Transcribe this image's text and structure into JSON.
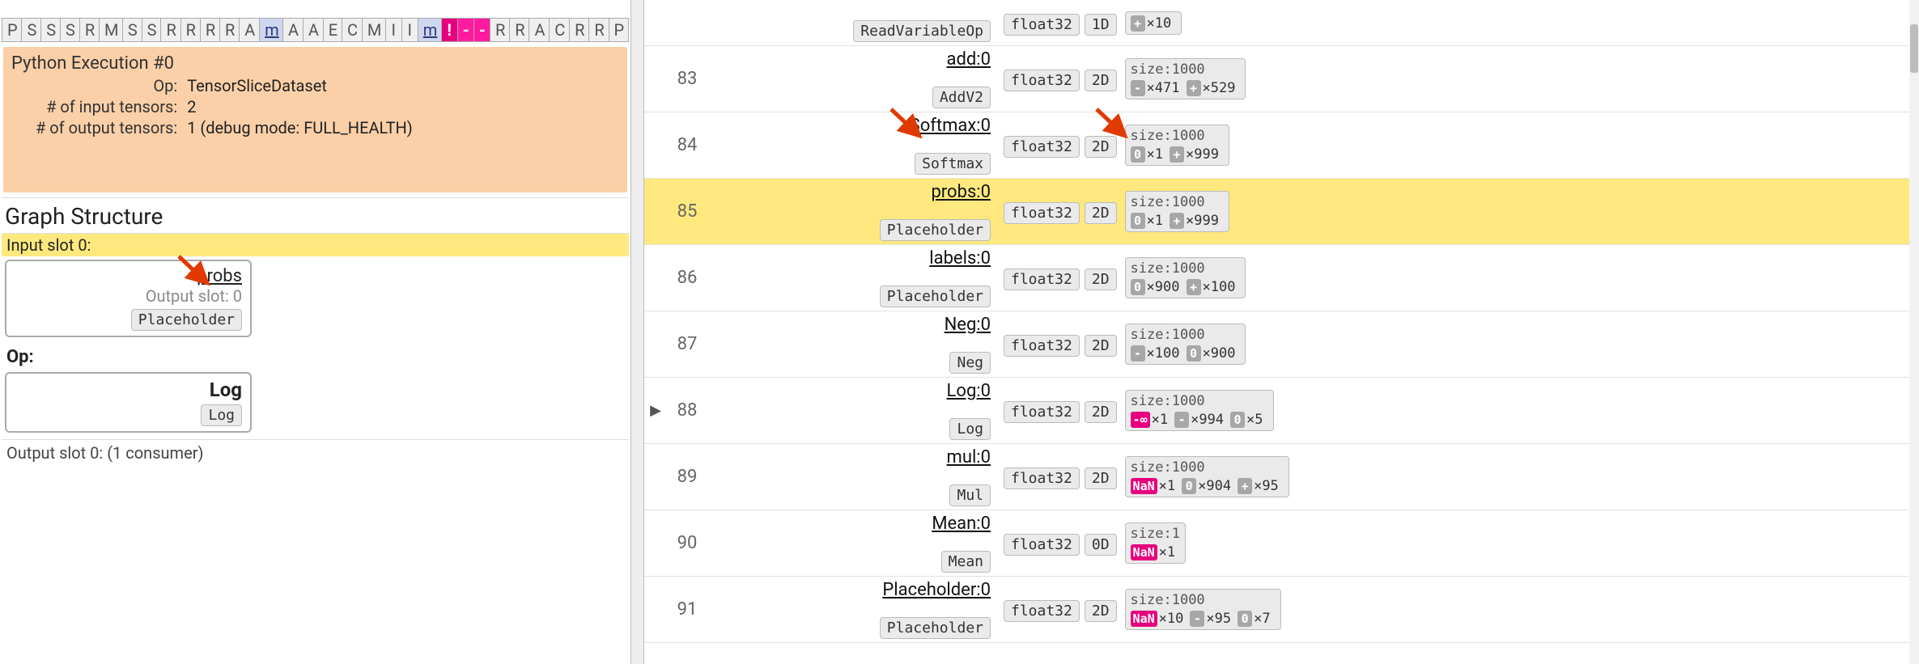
{
  "breadcrumb": [
    "P",
    "S",
    "S",
    "S",
    "R",
    "M",
    "S",
    "S",
    "R",
    "R",
    "R",
    "R",
    "A",
    "m",
    "A",
    "A",
    "E",
    "C",
    "M",
    "I",
    "I",
    "m",
    "!",
    "-",
    "-",
    "R",
    "R",
    "A",
    "C",
    "R",
    "R",
    "P"
  ],
  "breadcrumb_styles": {
    "13": "underline",
    "21": "underline",
    "22": "magenta",
    "23": "magenta hl",
    "24": "magenta hl"
  },
  "detail": {
    "title": "Python Execution #0",
    "rows": [
      {
        "k": "Op:",
        "v": "TensorSliceDataset"
      },
      {
        "k": "# of input tensors:",
        "v": "2"
      },
      {
        "k": "# of output tensors:",
        "v": "1   (debug mode: FULL_HEALTH)"
      }
    ]
  },
  "graph_structure_heading": "Graph Structure",
  "input_slot_label": "Input slot 0:",
  "input_slot": {
    "name": "probs",
    "sub": "Output slot: 0",
    "chip": "Placeholder"
  },
  "op_label": "Op:",
  "op_box": {
    "name": "Log",
    "chip": "Log"
  },
  "output_slot_label": "Output slot 0: (1 consumer)",
  "rows": [
    {
      "idx": "",
      "name": "",
      "op": "ReadVariableOp",
      "dtype": "float32",
      "dims": "1D",
      "size": "",
      "stats": [
        {
          "tag": "plus",
          "txt": "×10"
        }
      ],
      "partial_top": true
    },
    {
      "idx": "83",
      "name": "add:0",
      "op": "AddV2",
      "dtype": "float32",
      "dims": "2D",
      "size": "size:1000",
      "stats": [
        {
          "tag": "minus",
          "txt": "×471"
        },
        {
          "tag": "plus",
          "txt": "×529"
        }
      ]
    },
    {
      "idx": "84",
      "name": "Softmax:0",
      "op": "Softmax",
      "dtype": "float32",
      "dims": "2D",
      "size": "size:1000",
      "stats": [
        {
          "tag": "zero",
          "txt": "×1"
        },
        {
          "tag": "plus",
          "txt": "×999"
        }
      ]
    },
    {
      "idx": "85",
      "name": "probs:0",
      "op": "Placeholder",
      "dtype": "float32",
      "dims": "2D",
      "size": "size:1000",
      "stats": [
        {
          "tag": "zero",
          "txt": "×1"
        },
        {
          "tag": "plus",
          "txt": "×999"
        }
      ],
      "highlight": true
    },
    {
      "idx": "86",
      "name": "labels:0",
      "op": "Placeholder",
      "dtype": "float32",
      "dims": "2D",
      "size": "size:1000",
      "stats": [
        {
          "tag": "zero",
          "txt": "×900"
        },
        {
          "tag": "plus",
          "txt": "×100"
        }
      ]
    },
    {
      "idx": "87",
      "name": "Neg:0",
      "op": "Neg",
      "dtype": "float32",
      "dims": "2D",
      "size": "size:1000",
      "stats": [
        {
          "tag": "minus",
          "txt": "×100"
        },
        {
          "tag": "zero",
          "txt": "×900"
        }
      ]
    },
    {
      "idx": "88",
      "name": "Log:0",
      "op": "Log",
      "dtype": "float32",
      "dims": "2D",
      "size": "size:1000",
      "stats": [
        {
          "tag": "neginf",
          "txt": "×1"
        },
        {
          "tag": "minus",
          "txt": "×994"
        },
        {
          "tag": "zero",
          "txt": "×5"
        }
      ],
      "expandable": true
    },
    {
      "idx": "89",
      "name": "mul:0",
      "op": "Mul",
      "dtype": "float32",
      "dims": "2D",
      "size": "size:1000",
      "stats": [
        {
          "tag": "nan",
          "txt": "×1"
        },
        {
          "tag": "zero",
          "txt": "×904"
        },
        {
          "tag": "plus",
          "txt": "×95"
        }
      ]
    },
    {
      "idx": "90",
      "name": "Mean:0",
      "op": "Mean",
      "dtype": "float32",
      "dims": "0D",
      "size": "size:1",
      "stats": [
        {
          "tag": "nan",
          "txt": "×1"
        }
      ]
    },
    {
      "idx": "91",
      "name": "Placeholder:0",
      "op": "Placeholder",
      "dtype": "float32",
      "dims": "2D",
      "size": "size:1000",
      "stats": [
        {
          "tag": "nan",
          "txt": "×10"
        },
        {
          "tag": "minus",
          "txt": "×95"
        },
        {
          "tag": "zero",
          "txt": "×7"
        }
      ]
    }
  ],
  "tag_text": {
    "minus": "-",
    "plus": "+",
    "zero": "0",
    "neginf": "-∞",
    "nan": "NaN"
  }
}
